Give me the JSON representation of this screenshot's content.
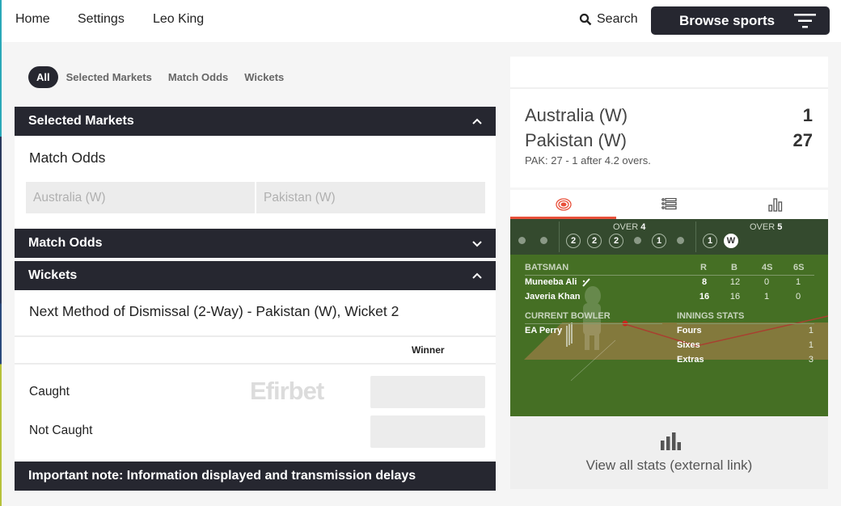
{
  "topnav": {
    "links": [
      "Home",
      "Settings",
      "Leo King"
    ],
    "search_label": "Search",
    "browse_label": "Browse sports"
  },
  "filters": {
    "pills": [
      "All",
      "Selected Markets",
      "Match Odds",
      "Wickets"
    ],
    "active": "All"
  },
  "sections": {
    "selected_markets": {
      "title": "Selected Markets",
      "expanded": true,
      "market_title": "Match Odds",
      "selections": [
        "Australia (W)",
        "Pakistan (W)"
      ]
    },
    "match_odds": {
      "title": "Match Odds",
      "expanded": false
    },
    "wickets": {
      "title": "Wickets",
      "expanded": true,
      "market_title": "Next Method of Dismissal (2-Way) - Pakistan (W), Wicket 2",
      "column_header": "Winner",
      "rows": [
        "Caught",
        "Not Caught"
      ],
      "watermark": "Efirbet"
    }
  },
  "important_note": "Important note: Information displayed and transmission delays",
  "scoreboard": {
    "teams": [
      {
        "name": "Australia (W)",
        "score": "1"
      },
      {
        "name": "Pakistan (W)",
        "score": "27"
      }
    ],
    "summary": "PAK: 27 - 1 after 4.2 overs."
  },
  "tracker_tabs": [
    {
      "icon": "pitch-icon",
      "active": true
    },
    {
      "icon": "list-icon",
      "active": false
    },
    {
      "icon": "bar-chart-icon",
      "active": false
    }
  ],
  "overs": {
    "prev_tail": [
      "•",
      "•"
    ],
    "over4": {
      "label": "OVER",
      "number": "4",
      "balls": [
        "2",
        "2",
        "2",
        "•",
        "1",
        "•"
      ]
    },
    "over5": {
      "label": "OVER",
      "number": "5",
      "balls": [
        "1",
        "W"
      ]
    }
  },
  "batsmen": {
    "header": {
      "label": "BATSMAN",
      "cols": [
        "R",
        "B",
        "4S",
        "6S"
      ]
    },
    "rows": [
      {
        "name": "Muneeba Ali",
        "on_strike": true,
        "R": "8",
        "B": "12",
        "4S": "0",
        "6S": "1"
      },
      {
        "name": "Javeria Khan",
        "on_strike": false,
        "R": "16",
        "B": "16",
        "4S": "1",
        "6S": "0"
      }
    ]
  },
  "bowler": {
    "header": "CURRENT BOWLER",
    "name": "EA Perry"
  },
  "innings_stats": {
    "header": "INNINGS STATS",
    "rows": [
      {
        "label": "Fours",
        "value": "1"
      },
      {
        "label": "Sixes",
        "value": "1"
      },
      {
        "label": "Extras",
        "value": "3"
      }
    ]
  },
  "stats_link": "View all stats (external link)",
  "colors": {
    "dark": "#262730",
    "accent": "#e8503a",
    "pitch": "#456f24"
  }
}
